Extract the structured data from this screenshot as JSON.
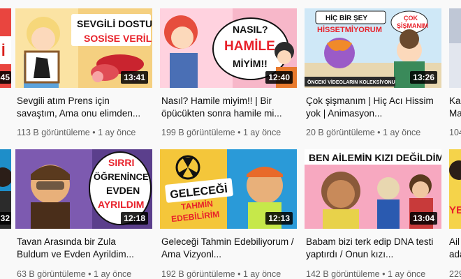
{
  "videos": [
    {
      "duration": "13:41",
      "title": "Sevgili atım Prens için savaştım, Ama onu elimden...",
      "views": "113 B görüntüleme",
      "sep": "•",
      "age": "1 ay önce",
      "thumb_text": [
        "SEVGİLİ DOSTUM",
        "SOSİSE VERİLDİ"
      ]
    },
    {
      "duration": "12:40",
      "title": "Nasıl? Hamile miyim!! | Bir öpücükten sonra hamile mi...",
      "views": "199 B görüntüleme",
      "sep": "•",
      "age": "1 ay önce",
      "thumb_text": [
        "NASIL?",
        "HAMİLE",
        "MİYİM!!"
      ]
    },
    {
      "duration": "13:26",
      "title": "Çok şişmanım | Hiç Acı Hissim yok | Animasyon...",
      "views": "20 B görüntüleme",
      "sep": "•",
      "age": "1 ay önce",
      "thumb_text": [
        "HİÇ BİR ŞEY",
        "HİSSETMİYORUM",
        "ÇOK",
        "ŞİŞMANIM",
        "ÖNCEKİ VİDEOLARIN KOLEKSİYONU"
      ]
    },
    {
      "duration": "12:18",
      "title": "Tavan Arasında bir Zula Buldum ve Evden Ayrildim...",
      "views": "63 B görüntüleme",
      "sep": "•",
      "age": "1 ay önce",
      "thumb_text": [
        "SIRRI",
        "ÖĞRENİNCE",
        "EVDEN",
        "AYRILDIM"
      ]
    },
    {
      "duration": "12:13",
      "title": "Geleceği Tahmin Edebiliyorum / Ama Vizyonl...",
      "views": "192 B görüntüleme",
      "sep": "•",
      "age": "1 ay önce",
      "thumb_text": [
        "GELECEĞİ",
        "TAHMİN",
        "EDEBİLİRİM"
      ]
    },
    {
      "duration": "13:04",
      "title": "Babam bizi terk edip DNA testi yaptırdı / Onun kızı...",
      "views": "142 B görüntüleme",
      "sep": "•",
      "age": "1 ay önce",
      "thumb_text": [
        "BEN AİLEMİN KIZI DEĞİLDİM"
      ]
    }
  ],
  "edge_left": {
    "row1": {
      "duration_partial": "45",
      "thumb_text": "İ"
    },
    "row2": {
      "duration_partial": "32"
    }
  },
  "edge_right": {
    "row1": {
      "title_partial": [
        "Ka",
        "Ma"
      ],
      "views_partial": "104"
    },
    "row2": {
      "title_partial": [
        "Ail",
        "ada"
      ],
      "views_partial": "229",
      "thumb_text": "YE"
    }
  },
  "colors": {
    "duration_bg": "#000000",
    "meta": "#606060",
    "title": "#0f0f0f",
    "background": "#f9f9f9"
  }
}
